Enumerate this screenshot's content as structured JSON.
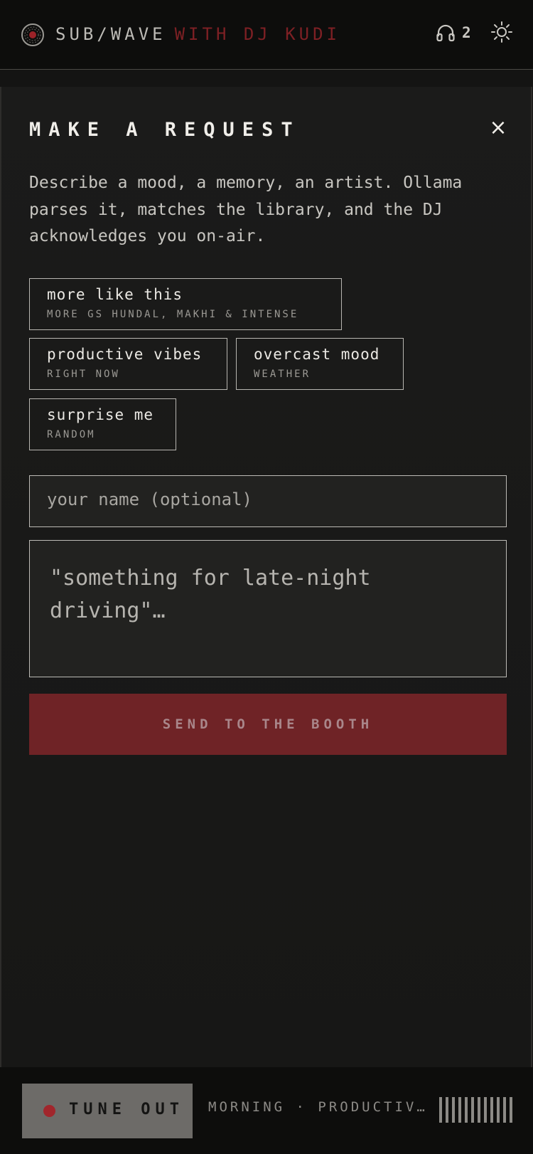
{
  "header": {
    "brand_name": "SUB/WAVE",
    "brand_dj": "WITH DJ KUDI",
    "listener_count": "2",
    "icons": {
      "logo": "vinyl-record-icon",
      "listeners": "headphones-icon",
      "theme": "sun-icon"
    }
  },
  "request_panel": {
    "title": "MAKE A REQUEST",
    "close_label": "×",
    "description": "Describe a mood, a memory, an artist. Ollama parses it, matches the library, and the DJ acknowledges you on-air.",
    "suggestions": [
      {
        "label": "more like this",
        "sub": "MORE GS HUNDAL, MAKHI & INTENSE"
      },
      {
        "label": "productive vibes",
        "sub": "RIGHT NOW"
      },
      {
        "label": "overcast mood",
        "sub": "WEATHER"
      },
      {
        "label": "surprise me",
        "sub": "RANDOM"
      }
    ],
    "name_placeholder": "your name (optional)",
    "request_placeholder": "\"something for late-night driving\"…",
    "send_label": "SEND TO THE BOOTH"
  },
  "player": {
    "tune_label": "TUNE OUT",
    "now_playing": "MORNING · PRODUCTIV…",
    "colors": {
      "accent": "#7d2024",
      "record_dot": "#a1262c",
      "send_bg": "#6f2326"
    }
  }
}
